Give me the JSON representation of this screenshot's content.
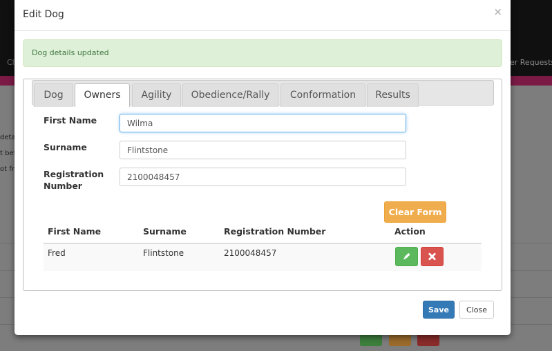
{
  "background": {
    "nav_left_label": "Cl",
    "nav_right_label": "er Requests",
    "side_text": [
      "deta",
      "t bef",
      "ot fr"
    ],
    "row_buttons": [
      {
        "icon": "pencil-icon",
        "color": "#3d7f3d"
      },
      {
        "icon": "close-icon",
        "color": "#9a6b2a"
      },
      {
        "icon": "trash-icon",
        "color": "#8a2c2a"
      }
    ]
  },
  "modal": {
    "title": "Edit Dog",
    "close_glyph": "×",
    "alert": "Dog details updated",
    "tabs": [
      {
        "label": "Dog",
        "active": false
      },
      {
        "label": "Owners",
        "active": true
      },
      {
        "label": "Agility",
        "active": false
      },
      {
        "label": "Obedience/Rally",
        "active": false
      },
      {
        "label": "Conformation",
        "active": false
      },
      {
        "label": "Results",
        "active": false
      }
    ],
    "form": {
      "first_name_label": "First Name",
      "first_name_value": "Wilma",
      "surname_label": "Surname",
      "surname_value": "Flintstone",
      "registration_label_line1": "Registration",
      "registration_label_line2": "Number",
      "registration_value": "2100048457",
      "clear_button": "Clear Form"
    },
    "table": {
      "headers": [
        "First Name",
        "Surname",
        "Registration Number",
        "Action"
      ],
      "rows": [
        {
          "first_name": "Fred",
          "surname": "Flintstone",
          "registration": "2100048457"
        }
      ]
    },
    "footer": {
      "save": "Save",
      "close": "Close"
    }
  },
  "colors": {
    "success": "#5cb85c",
    "danger": "#d9534f",
    "warning": "#f0ad4e",
    "primary": "#337ab7",
    "alert_bg": "#dff0d8",
    "alert_text": "#3c763d"
  }
}
